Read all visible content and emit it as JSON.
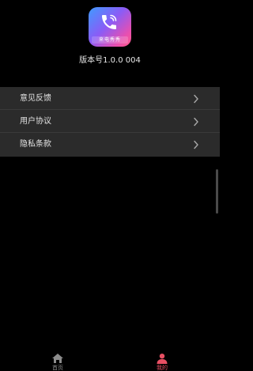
{
  "app": {
    "logo_text": "来电秀秀",
    "version": "版本号1.0.0 004"
  },
  "menu": {
    "items": [
      {
        "label": "意见反馈"
      },
      {
        "label": "用户协议"
      },
      {
        "label": "隐私条款"
      }
    ]
  },
  "tabbar": {
    "tabs": [
      {
        "label": "首页",
        "icon": "home-icon",
        "active": false
      },
      {
        "label": "我的",
        "icon": "user-icon",
        "active": true
      }
    ]
  },
  "colors": {
    "background": "#000000",
    "menu_background": "#2b2b2b",
    "accent": "#e84f63",
    "text": "#e6e6e6"
  }
}
